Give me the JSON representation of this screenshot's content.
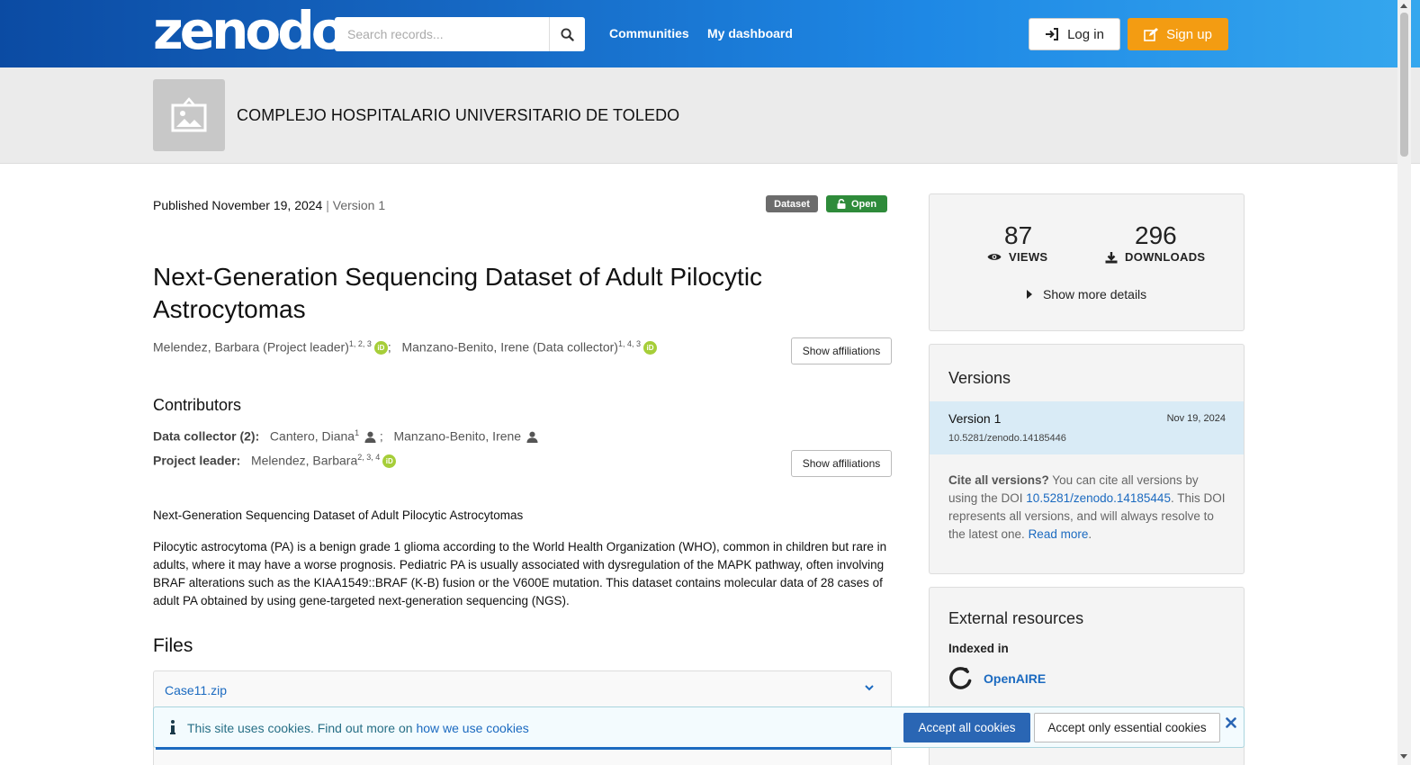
{
  "header": {
    "logo_text": "zenodo",
    "search_placeholder": "Search records...",
    "nav": [
      "Communities",
      "My dashboard"
    ],
    "login_label": "Log in",
    "signup_label": "Sign up"
  },
  "community": {
    "name": "COMPLEJO HOSPITALARIO UNIVERSITARIO DE TOLEDO"
  },
  "record": {
    "published": "Published November 19, 2024",
    "separator": "|",
    "version": "Version 1",
    "badge_type": "Dataset",
    "badge_access": "Open",
    "title": "Next-Generation Sequencing Dataset of Adult Pilocytic Astrocytomas",
    "creators": [
      {
        "name": "Melendez, Barbara (Project leader)",
        "sup": "1, 2, 3"
      },
      {
        "name": "Manzano-Benito, Irene (Data collector)",
        "sup": "1, 4, 3"
      }
    ],
    "show_affiliations": "Show affiliations",
    "contributors_heading": "Contributors",
    "data_collector_label": "Data collector (2):",
    "data_collectors": [
      {
        "name": "Cantero, Diana",
        "sup": "1"
      },
      {
        "name": "Manzano-Benito, Irene",
        "sup": ""
      }
    ],
    "project_leader_label": "Project leader:",
    "project_leader": {
      "name": "Melendez, Barbara",
      "sup": "2, 3, 4"
    },
    "description_title": "Next-Generation Sequencing Dataset of Adult Pilocytic Astrocytomas",
    "description": "Pilocytic astrocytoma (PA) is a benign grade 1 glioma according to the World Health Organization (WHO), common in children but rare in adults, where it may have a worse prognosis. Pediatric PA is usually associated with dysregulation of the MAPK pathway, often involving BRAF alterations such as the KIAA1549::BRAF (K-B) fusion or the V600E mutation. This dataset contains molecular data of 28 cases of adult PA obtained by using gene-targeted next-generation sequencing (NGS).",
    "files_heading": "Files",
    "files": [
      "Case11.zip"
    ]
  },
  "stats": {
    "views": "87",
    "views_label": "VIEWS",
    "downloads": "296",
    "downloads_label": "DOWNLOADS",
    "show_more": "Show more details"
  },
  "versions": {
    "heading": "Versions",
    "current": {
      "name": "Version 1",
      "doi": "10.5281/zenodo.14185446",
      "date": "Nov 19, 2024"
    },
    "cite_bold": "Cite all versions?",
    "cite_text_1": " You can cite all versions by using the DOI ",
    "cite_doi": "10.5281/zenodo.14185445",
    "cite_text_2": ". This DOI represents all versions, and will always resolve to the latest one. ",
    "read_more": "Read more",
    "cite_end": "."
  },
  "external": {
    "heading": "External resources",
    "indexed_in": "Indexed in",
    "openaire": "OpenAIRE"
  },
  "cookie": {
    "text": "This site uses cookies. Find out more on ",
    "link": "how we use cookies",
    "accept_all": "Accept all cookies",
    "accept_essential": "Accept only essential cookies"
  },
  "colors": {
    "brand_blue": "#1565c0",
    "signup_orange": "#f39c12",
    "open_green": "#2e8b3a",
    "dataset_grey": "#6c6c6c",
    "link_blue": "#1b6ac0"
  }
}
